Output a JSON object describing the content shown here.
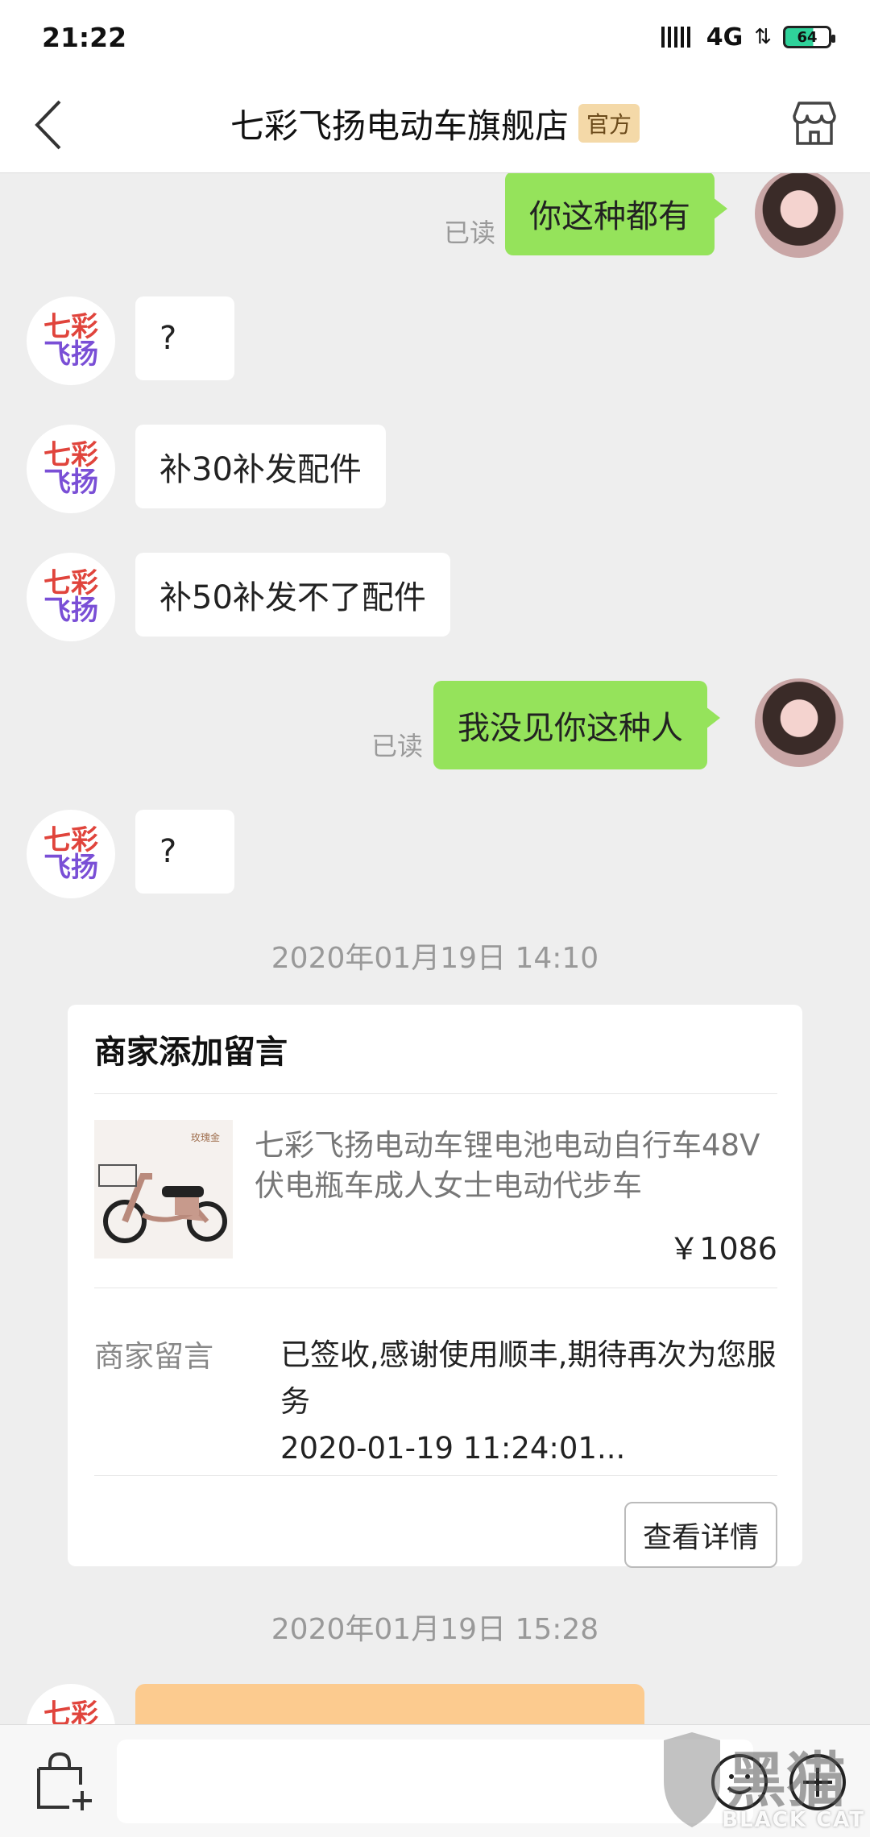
{
  "status_bar": {
    "time": "21:22",
    "network": "4G",
    "battery": "64"
  },
  "header": {
    "title": "七彩飞扬电动车旗舰店",
    "badge": "官方"
  },
  "shop": {
    "logo_line1": "七彩",
    "logo_line2": "飞扬"
  },
  "messages": [
    {
      "from": "user",
      "text": "你这种都有",
      "read_label": "已读"
    },
    {
      "from": "shop",
      "text": "?"
    },
    {
      "from": "shop",
      "text": "补30补发配件"
    },
    {
      "from": "shop",
      "text": "补50补发不了配件"
    },
    {
      "from": "user",
      "text": "我没见你这种人",
      "read_label": "已读"
    },
    {
      "from": "shop",
      "text": "?"
    }
  ],
  "timestamps": {
    "first": "2020年01月19日 14:10",
    "second": "2020年01月19日 15:28"
  },
  "card": {
    "title": "商家添加留言",
    "product_name": "七彩飞扬电动车锂电池电动自行车48V伏电瓶车成人女士电动代步车",
    "product_thumb_caption": "玫瑰金",
    "price": "￥1086",
    "msg_label": "商家留言",
    "msg_text": "已签收,感谢使用顺丰,期待再次为您服务",
    "msg_time": "2020-01-19 11:24:01...",
    "detail_button": "查看详情"
  },
  "input": {
    "placeholder": ""
  },
  "watermark": {
    "text": "BLACK CAT",
    "big": "黑猫"
  },
  "colors": {
    "outgoing_bubble": "#95e35b",
    "incoming_bubble": "#ffffff",
    "official_badge": "#f4d9a8",
    "partial_bubble": "#fccb8f"
  }
}
